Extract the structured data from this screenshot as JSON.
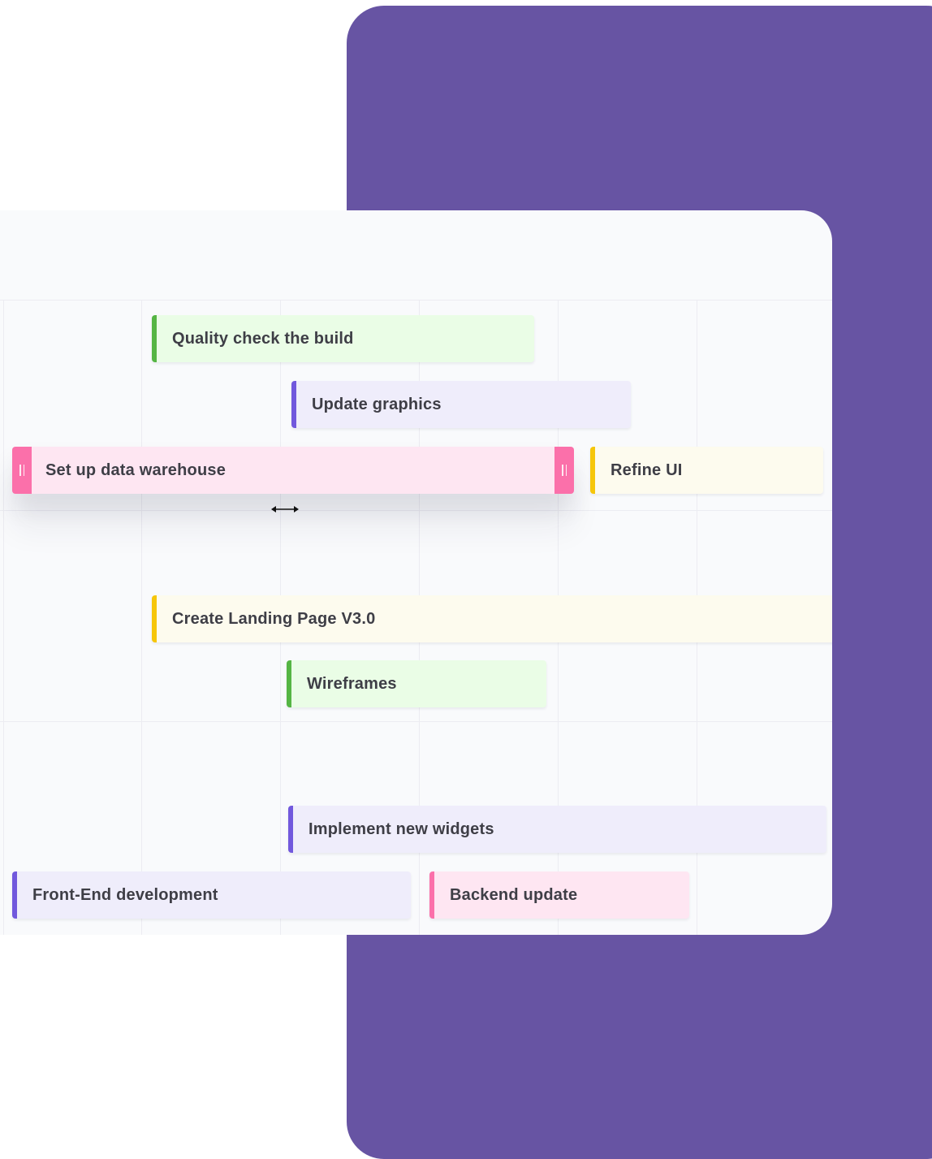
{
  "colors": {
    "brand_purple": "#6754a3",
    "green_bg": "#eafde6",
    "green_bar": "#55b544",
    "purple_bg": "#efedfb",
    "purple_bar": "#7158dd",
    "pink_bg": "#fee6f2",
    "pink_bar": "#fb70aa",
    "yellow_bg": "#fdfbee",
    "yellow_bar": "#f6c60a"
  },
  "tasks": [
    {
      "label": "Quality check the build",
      "color": "green"
    },
    {
      "label": "Update graphics",
      "color": "purple"
    },
    {
      "label": "Set up data warehouse",
      "color": "pink",
      "selected": true
    },
    {
      "label": "Refine UI",
      "color": "yellow"
    },
    {
      "label": "Create Landing Page V3.0",
      "color": "yellow"
    },
    {
      "label": "Wireframes",
      "color": "green"
    },
    {
      "label": "Implement new widgets",
      "color": "purple"
    },
    {
      "label": "Front-End development",
      "color": "purple"
    },
    {
      "label": "Backend update",
      "color": "pink"
    }
  ],
  "icons": {
    "resize_cursor": "horizontal-resize-cursor-icon",
    "drag_handle": "drag-handle-icon"
  }
}
